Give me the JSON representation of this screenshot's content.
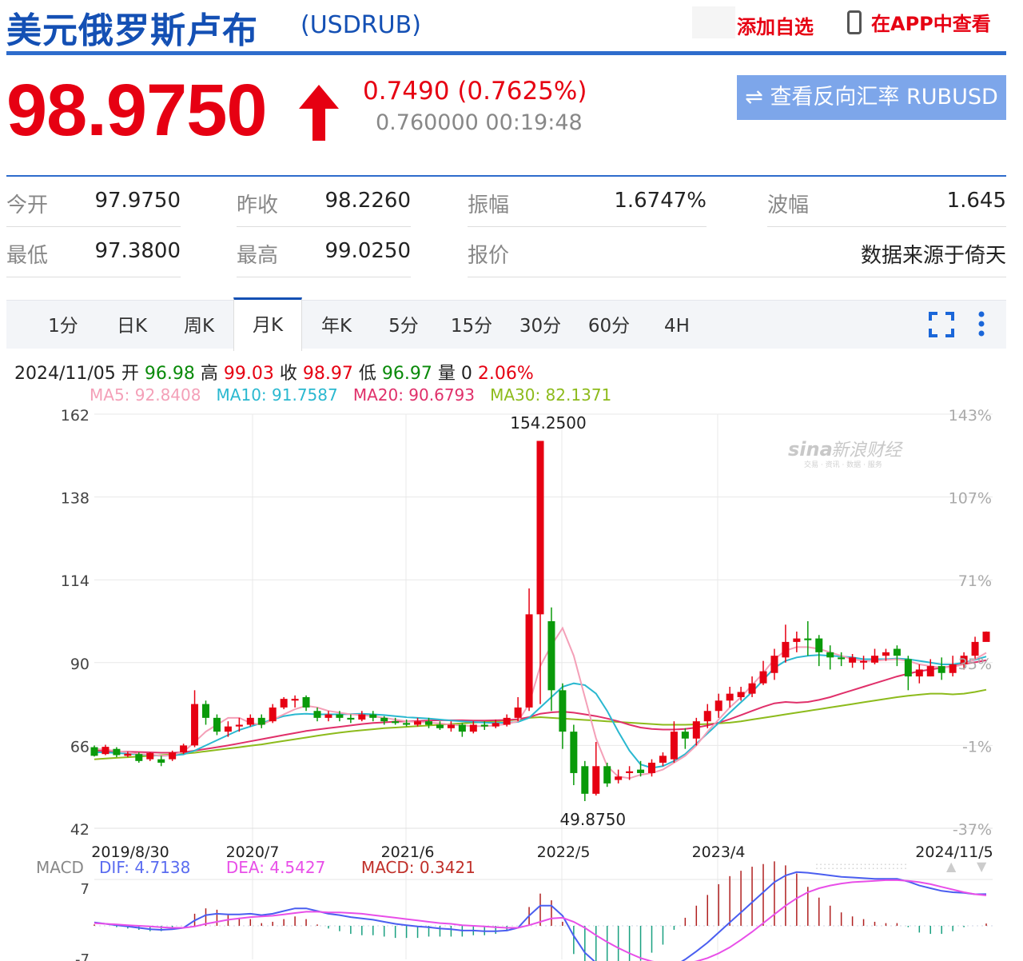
{
  "header": {
    "title": "美元俄罗斯卢布",
    "code": "(USDRUB)",
    "add_watchlist": "添加自选",
    "app_view": "在APP中查看"
  },
  "quote": {
    "price": "98.9750",
    "change": "0.7490 (0.7625%)",
    "bid_time": "0.760000 00:19:48",
    "reverse_button": "查看反向汇率 RUBUSD",
    "direction": "up",
    "up_color": "#e60012"
  },
  "stats": {
    "row1": [
      {
        "label": "今开",
        "value": "97.9750"
      },
      {
        "label": "昨收",
        "value": "98.2260"
      },
      {
        "label": "振幅",
        "value": "1.6747%"
      },
      {
        "label": "波幅",
        "value": "1.645"
      }
    ],
    "row2": [
      {
        "label": "最低",
        "value": "97.3800"
      },
      {
        "label": "最高",
        "value": "99.0250"
      },
      {
        "label": "报价",
        "value": ""
      },
      {
        "label": "",
        "value": "数据来源于倚天"
      }
    ]
  },
  "tabs": [
    "1分",
    "日K",
    "周K",
    "月K",
    "年K",
    "5分",
    "15分",
    "30分",
    "60分",
    "4H"
  ],
  "active_tab": "月K",
  "info": {
    "date": "2024/11/05",
    "open_label": "开",
    "open": "96.98",
    "high_label": "高",
    "high": "99.03",
    "close_label": "收",
    "close": "98.97",
    "low_label": "低",
    "low": "96.97",
    "vol_label": "量",
    "vol": "0",
    "pct": "2.06%",
    "ma5": "MA5: 92.8408",
    "ma10": "MA10: 91.7587",
    "ma20": "MA20: 90.6793",
    "ma30": "MA30: 82.1371"
  },
  "chart_data": {
    "type": "candlestick",
    "y_ticks": [
      42,
      66,
      90,
      114,
      138,
      162
    ],
    "y_pct_ticks": [
      "143%",
      "107%",
      "71%",
      "35%",
      "-1%",
      "-37%"
    ],
    "ylim": [
      42,
      162
    ],
    "x_labels": [
      "2019/8/30",
      "2020/7",
      "2021/6",
      "2022/5",
      "2023/4",
      "2024/11/5"
    ],
    "annotations": {
      "max": "154.2500",
      "min": "49.8750"
    },
    "watermark": "新浪财经",
    "colors": {
      "up": "#e60012",
      "down": "#0a9a0a",
      "ma5": "#f4a0b8",
      "ma10": "#2ab8d0",
      "ma20": "#e0306a",
      "ma30": "#8dbb1c"
    },
    "candles": [
      [
        65.5,
        63.0,
        66.0,
        62.8
      ],
      [
        63.5,
        65.6,
        66.2,
        63.2
      ],
      [
        65.0,
        63.2,
        65.5,
        62.6
      ],
      [
        63.0,
        63.6,
        64.2,
        62.6
      ],
      [
        63.5,
        61.5,
        64.0,
        61.0
      ],
      [
        62.0,
        63.8,
        64.0,
        61.5
      ],
      [
        62.0,
        61.0,
        63.0,
        60.0
      ],
      [
        62.0,
        64.0,
        64.5,
        61.5
      ],
      [
        64.0,
        66.0,
        66.5,
        63.5
      ],
      [
        66.0,
        78.0,
        82.0,
        65.5
      ],
      [
        78.0,
        74.0,
        79.0,
        72.0
      ],
      [
        74.0,
        70.0,
        75.0,
        69.0
      ],
      [
        70.0,
        71.5,
        73.0,
        68.5
      ],
      [
        71.5,
        72.0,
        74.0,
        70.0
      ],
      [
        72.0,
        74.0,
        75.0,
        71.5
      ],
      [
        74.0,
        72.0,
        75.0,
        71.0
      ],
      [
        73.0,
        77.0,
        78.0,
        72.5
      ],
      [
        77.0,
        79.5,
        80.0,
        76.5
      ],
      [
        79.0,
        79.5,
        80.5,
        77.0
      ],
      [
        80.0,
        77.0,
        80.5,
        76.0
      ],
      [
        76.0,
        74.0,
        77.0,
        73.0
      ],
      [
        74.0,
        75.0,
        76.0,
        73.0
      ],
      [
        75.0,
        74.0,
        76.0,
        73.0
      ],
      [
        74.0,
        73.5,
        75.0,
        72.5
      ],
      [
        73.5,
        75.0,
        76.0,
        73.0
      ],
      [
        75.0,
        74.0,
        76.0,
        73.0
      ],
      [
        74.0,
        73.0,
        74.5,
        72.0
      ],
      [
        73.0,
        72.5,
        74.0,
        72.0
      ],
      [
        72.5,
        72.0,
        73.5,
        71.5
      ],
      [
        72.0,
        73.0,
        74.0,
        71.5
      ],
      [
        73.0,
        72.0,
        74.0,
        71.0
      ],
      [
        72.0,
        71.0,
        73.0,
        70.5
      ],
      [
        71.0,
        72.0,
        73.0,
        70.0
      ],
      [
        72.0,
        70.0,
        72.5,
        68.5
      ],
      [
        70.0,
        72.0,
        73.0,
        69.5
      ],
      [
        72.0,
        71.5,
        73.0,
        70.5
      ],
      [
        71.5,
        72.5,
        73.5,
        71.0
      ],
      [
        72.0,
        74.0,
        75.0,
        71.5
      ],
      [
        74.0,
        77.0,
        80.0,
        73.0
      ],
      [
        77.0,
        104.0,
        111.5,
        76.0
      ],
      [
        104.0,
        154.25,
        154.25,
        78.0
      ],
      [
        102.0,
        82.0,
        106.0,
        76.0
      ],
      [
        82.0,
        70.0,
        84.0,
        65.0
      ],
      [
        70.0,
        58.0,
        72.0,
        54.5
      ],
      [
        60.0,
        52.0,
        61.5,
        49.875
      ],
      [
        52.0,
        60.0,
        67.0,
        51.5
      ],
      [
        60.0,
        55.0,
        61.0,
        54.0
      ],
      [
        56.0,
        57.0,
        59.0,
        55.0
      ],
      [
        58.0,
        58.5,
        60.0,
        56.0
      ],
      [
        59.0,
        58.0,
        61.5,
        57.0
      ],
      [
        58.0,
        61.0,
        62.0,
        57.0
      ],
      [
        61.0,
        63.0,
        64.0,
        60.0
      ],
      [
        62.0,
        70.0,
        73.0,
        61.0
      ],
      [
        70.0,
        68.0,
        71.0,
        65.0
      ],
      [
        68.0,
        73.0,
        74.0,
        66.0
      ],
      [
        73.0,
        76.0,
        78.0,
        71.0
      ],
      [
        76.0,
        79.0,
        81.0,
        74.0
      ],
      [
        79.0,
        81.0,
        83.0,
        77.0
      ],
      [
        80.0,
        81.5,
        83.0,
        79.0
      ],
      [
        81.0,
        84.0,
        86.0,
        80.0
      ],
      [
        84.0,
        87.5,
        90.5,
        83.5
      ],
      [
        87.0,
        92.0,
        94.0,
        85.0
      ],
      [
        91.5,
        96.0,
        101.0,
        90.0
      ],
      [
        96.0,
        97.0,
        99.0,
        93.0
      ],
      [
        97.0,
        96.5,
        102.0,
        92.0
      ],
      [
        97.0,
        93.0,
        98.0,
        89.0
      ],
      [
        93.0,
        91.5,
        95.0,
        88.0
      ],
      [
        91.5,
        91.0,
        93.0,
        89.0
      ],
      [
        90.0,
        91.5,
        92.5,
        88.5
      ],
      [
        90.0,
        90.5,
        92.0,
        88.0
      ],
      [
        90.0,
        92.0,
        94.0,
        89.5
      ],
      [
        92.0,
        93.0,
        94.0,
        90.5
      ],
      [
        94.0,
        92.0,
        95.0,
        89.0
      ],
      [
        91.0,
        86.0,
        92.0,
        82.0
      ],
      [
        86.0,
        88.0,
        89.5,
        84.0
      ],
      [
        86.0,
        89.0,
        91.0,
        86.0
      ],
      [
        89.0,
        87.0,
        91.5,
        85.0
      ],
      [
        87.0,
        89.5,
        92.0,
        86.0
      ],
      [
        89.5,
        92.0,
        93.0,
        88.0
      ],
      [
        92.0,
        96.0,
        97.5,
        91.0
      ],
      [
        96.0,
        98.97,
        99.03,
        96.97
      ]
    ],
    "ma5": [
      65.0,
      64.8,
      64.4,
      64.0,
      63.5,
      63.4,
      63.0,
      63.2,
      64.2,
      67.0,
      70.0,
      72.0,
      74.0,
      74.0,
      72.5,
      72.0,
      73.5,
      75.0,
      76.5,
      77.5,
      77.0,
      76.0,
      75.5,
      75.0,
      74.8,
      74.5,
      74.0,
      73.5,
      73.0,
      72.8,
      72.6,
      72.4,
      72.0,
      71.8,
      71.6,
      71.6,
      71.8,
      72.2,
      73.0,
      78.0,
      89.0,
      95.0,
      100.0,
      92.0,
      80.0,
      68.0,
      60.0,
      57.0,
      56.5,
      57.5,
      58.0,
      59.0,
      61.0,
      63.0,
      66.0,
      70.0,
      73.5,
      77.0,
      80.0,
      83.5,
      87.0,
      91.0,
      93.5,
      94.5,
      94.5,
      94.0,
      93.0,
      92.0,
      91.0,
      90.5,
      90.5,
      90.8,
      91.0,
      90.5,
      89.5,
      89.0,
      88.5,
      88.8,
      89.5,
      91.0,
      92.84
    ],
    "ma10": [
      64.0,
      64.0,
      63.8,
      63.6,
      63.4,
      63.2,
      63.0,
      63.1,
      63.4,
      64.5,
      66.0,
      67.5,
      69.0,
      70.5,
      71.5,
      72.5,
      73.5,
      74.5,
      75.0,
      75.2,
      75.0,
      75.0,
      75.0,
      75.1,
      75.2,
      75.0,
      74.8,
      74.5,
      74.2,
      74.0,
      73.8,
      73.5,
      73.2,
      73.0,
      72.8,
      72.6,
      72.5,
      72.6,
      72.8,
      74.0,
      77.0,
      80.0,
      83.0,
      84.0,
      83.5,
      81.0,
      76.0,
      70.0,
      64.5,
      60.5,
      59.5,
      60.0,
      61.5,
      63.5,
      66.5,
      69.5,
      72.5,
      75.5,
      78.5,
      81.5,
      85.0,
      88.5,
      90.5,
      91.5,
      92.0,
      92.2,
      92.0,
      91.8,
      91.5,
      91.0,
      91.0,
      91.0,
      91.2,
      91.0,
      90.5,
      90.0,
      89.5,
      89.5,
      90.0,
      90.8,
      91.76
    ],
    "ma20": [
      64.5,
      64.4,
      64.3,
      64.2,
      64.1,
      64.0,
      63.9,
      63.9,
      64.0,
      64.5,
      65.0,
      65.5,
      66.0,
      66.6,
      67.2,
      67.8,
      68.4,
      69.0,
      69.6,
      70.2,
      70.6,
      71.0,
      71.4,
      71.8,
      72.2,
      72.5,
      72.7,
      72.9,
      73.0,
      73.1,
      73.2,
      73.3,
      73.3,
      73.3,
      73.2,
      73.2,
      73.3,
      73.4,
      73.6,
      74.2,
      75.2,
      75.6,
      75.8,
      75.5,
      75.0,
      74.5,
      73.8,
      73.0,
      72.0,
      71.2,
      70.8,
      70.6,
      70.6,
      70.8,
      71.2,
      71.8,
      72.6,
      73.6,
      74.8,
      76.0,
      77.2,
      78.2,
      78.6,
      78.4,
      78.6,
      79.2,
      80.0,
      81.0,
      82.0,
      83.0,
      84.0,
      85.0,
      86.0,
      86.8,
      87.5,
      88.0,
      88.5,
      89.0,
      89.6,
      90.1,
      90.68
    ],
    "ma30": [
      62.0,
      62.2,
      62.4,
      62.6,
      62.8,
      63.0,
      63.2,
      63.4,
      63.6,
      63.9,
      64.3,
      64.7,
      65.1,
      65.5,
      65.9,
      66.3,
      66.8,
      67.3,
      67.8,
      68.3,
      68.8,
      69.3,
      69.7,
      70.1,
      70.4,
      70.7,
      71.0,
      71.2,
      71.4,
      71.6,
      71.8,
      72.0,
      72.2,
      72.4,
      72.6,
      72.8,
      73.0,
      73.2,
      73.5,
      74.0,
      74.2,
      74.0,
      73.8,
      73.6,
      73.4,
      73.2,
      73.0,
      72.8,
      72.6,
      72.4,
      72.2,
      72.0,
      72.0,
      72.0,
      72.1,
      72.2,
      72.4,
      72.6,
      73.0,
      73.5,
      74.0,
      74.5,
      75.0,
      75.5,
      76.0,
      76.5,
      77.0,
      77.5,
      78.0,
      78.5,
      79.0,
      79.5,
      80.0,
      80.4,
      80.7,
      81.0,
      81.0,
      80.8,
      81.0,
      81.5,
      82.14
    ],
    "macd": {
      "label": "MACD",
      "dif_label": "DIF: 4.7138",
      "dea_label": "DEA: 4.5427",
      "macd_label": "MACD: 0.3421",
      "y_ticks": [
        "7",
        "-7"
      ],
      "dif": [
        0.5,
        0.3,
        0.1,
        -0.1,
        -0.3,
        -0.5,
        -0.6,
        -0.5,
        -0.3,
        0.8,
        1.6,
        1.8,
        1.7,
        1.7,
        1.8,
        1.6,
        1.8,
        2.2,
        2.6,
        2.6,
        2.2,
        1.8,
        1.6,
        1.3,
        1.1,
        0.9,
        0.6,
        0.3,
        0.1,
        -0.1,
        -0.2,
        -0.4,
        -0.5,
        -0.7,
        -0.7,
        -0.8,
        -0.8,
        -0.7,
        -0.3,
        1.5,
        3.0,
        3.0,
        1.5,
        -1.5,
        -4.0,
        -5.5,
        -6.5,
        -7.0,
        -7.3,
        -7.4,
        -7.3,
        -7.0,
        -6.0,
        -5.0,
        -3.8,
        -2.5,
        -1.0,
        0.5,
        2.0,
        3.5,
        5.0,
        6.5,
        7.5,
        8.0,
        7.9,
        7.7,
        7.5,
        7.3,
        7.2,
        7.1,
        7.0,
        7.0,
        7.0,
        6.6,
        6.0,
        5.6,
        5.2,
        5.0,
        4.9,
        4.7,
        4.71
      ],
      "dea": [
        0.4,
        0.3,
        0.2,
        0.1,
        0.0,
        -0.1,
        -0.2,
        -0.3,
        -0.3,
        -0.1,
        0.3,
        0.6,
        0.9,
        1.1,
        1.3,
        1.4,
        1.5,
        1.7,
        1.9,
        2.1,
        2.1,
        2.0,
        2.0,
        1.9,
        1.8,
        1.6,
        1.4,
        1.2,
        1.0,
        0.8,
        0.6,
        0.4,
        0.3,
        0.1,
        0.0,
        -0.1,
        -0.2,
        -0.3,
        -0.3,
        0.1,
        0.6,
        1.1,
        1.2,
        0.6,
        -0.3,
        -1.4,
        -2.4,
        -3.3,
        -4.1,
        -4.8,
        -5.3,
        -5.6,
        -5.7,
        -5.6,
        -5.3,
        -4.8,
        -4.1,
        -3.2,
        -2.1,
        -0.9,
        0.4,
        1.7,
        3.0,
        4.1,
        5.0,
        5.6,
        6.0,
        6.3,
        6.5,
        6.6,
        6.7,
        6.8,
        6.8,
        6.7,
        6.5,
        6.2,
        5.8,
        5.4,
        5.0,
        4.7,
        4.54
      ]
    }
  }
}
